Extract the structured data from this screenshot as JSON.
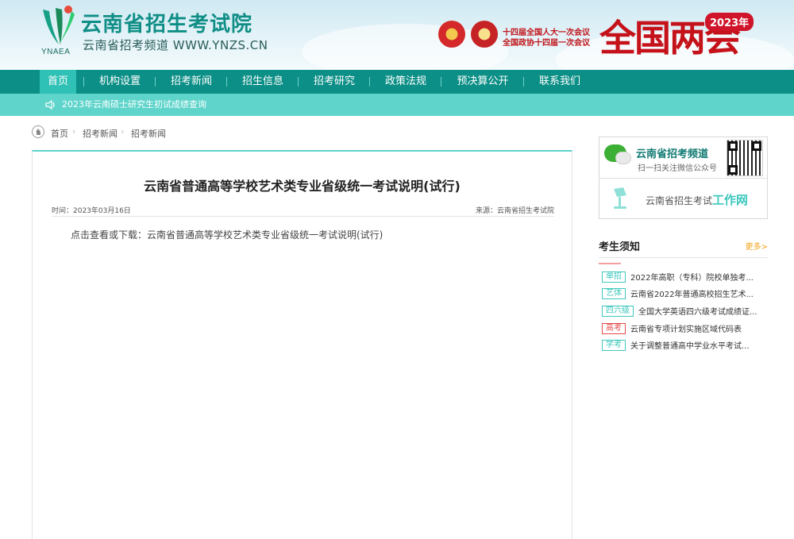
{
  "header": {
    "logo_en": "YNAEA",
    "site_title": "云南省招生考试院",
    "site_sub": "云南省招考频道  WWW.YNZS.CN",
    "meeting_line1": "十四届全国人大一次会议",
    "meeting_line2": "全国政协十四届一次会议",
    "banner_text": "全国两会",
    "banner_year": "2023年"
  },
  "nav": {
    "items": [
      {
        "label": "首页"
      },
      {
        "label": "机构设置"
      },
      {
        "label": "招考新闻"
      },
      {
        "label": "招生信息"
      },
      {
        "label": "招考研究"
      },
      {
        "label": "政策法规"
      },
      {
        "label": "预决算公开"
      },
      {
        "label": "联系我们"
      }
    ]
  },
  "notice": {
    "text": "2023年云南硕士研究生初试成绩查询"
  },
  "breadcrumb": {
    "items": [
      "首页",
      "招考新闻",
      "招考新闻"
    ]
  },
  "article": {
    "title": "云南省普通高等学校艺术类专业省级统一考试说明(试行)",
    "time": "时间：2023年03月16日",
    "source": "来源：云南省招生考试院",
    "body": "点击查看或下载：云南省普通高等学校艺术类专业省级统一考试说明(试行)"
  },
  "sidebar": {
    "wechat_title": "云南省招考频道",
    "wechat_sub": "扫一扫关注微信公众号",
    "work_prefix": "云南省招生考试",
    "work_highlight": "工作网",
    "notes_title": "考生须知",
    "more": "更多>",
    "notes": [
      {
        "tag": "单招",
        "title": "2022年高职（专科）院校单独考...",
        "tag_color": "#3ec8bd"
      },
      {
        "tag": "艺体",
        "title": "云南省2022年普通高校招生艺术...",
        "tag_color": "#3ec8bd"
      },
      {
        "tag": "四六级",
        "title": "全国大学英语四六级考试成绩证...",
        "tag_color": "#3ec8bd"
      },
      {
        "tag": "高考",
        "title": "云南省专项计划实施区域代码表",
        "tag_color": "#e64a4a"
      },
      {
        "tag": "学考",
        "title": "关于调整普通高中学业水平考试...",
        "tag_color": "#3ec8bd"
      }
    ]
  },
  "colors": {
    "brand": "#0b8f86",
    "accent": "#5ed4cb",
    "active_tab": "#2fc1b5",
    "banner_red": "#c5121a"
  }
}
